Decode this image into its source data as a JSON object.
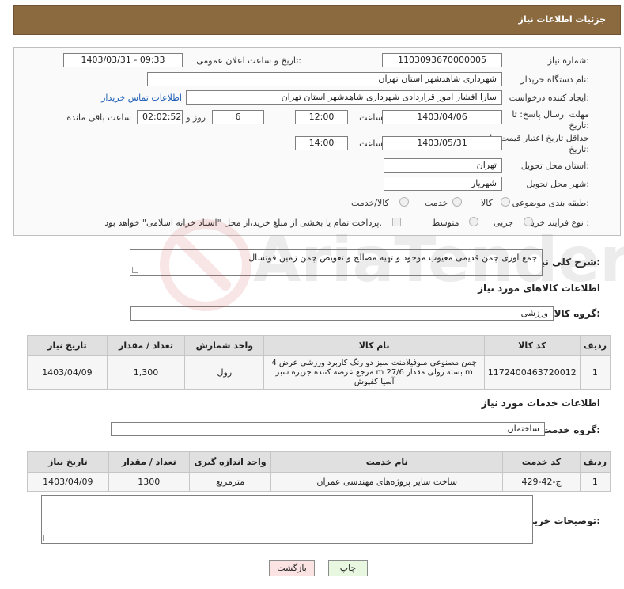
{
  "header": {
    "title": "جزئیات اطلاعات نیاز"
  },
  "info": {
    "need_number": {
      "label": "شماره نیاز:",
      "value": "1103093670000005"
    },
    "announce_datetime": {
      "label": "تاریخ و ساعت اعلان عمومی:",
      "value": "1403/03/31 - 09:33"
    },
    "buyer_org": {
      "label": "نام دستگاه خریدار:",
      "value": "شهرداری شاهدشهر استان تهران"
    },
    "requester": {
      "label": "ایجاد کننده درخواست:",
      "value": "سارا افشار امور قراردادی شهرداری شاهدشهر استان تهران",
      "contact_link": "اطلاعات تماس خریدار"
    },
    "reply_deadline": {
      "label": "مهلت ارسال پاسخ: تا تاریخ:",
      "date": "1403/04/06",
      "time_label": "ساعت",
      "time": "12:00",
      "days": "6",
      "days_label": "روز و",
      "remaining": "02:02:52",
      "remaining_label": "ساعت باقی مانده"
    },
    "price_validity": {
      "label": "حداقل تاریخ اعتبار قیمت: تا تاریخ:",
      "date": "1403/05/31",
      "time_label": "ساعت",
      "time": "14:00"
    },
    "delivery_province": {
      "label": "استان محل تحویل:",
      "value": "تهران"
    },
    "delivery_city": {
      "label": "شهر محل تحویل:",
      "value": "شهریار"
    },
    "category": {
      "label": "طبقه بندی موضوعی:",
      "options": [
        "کالا",
        "خدمت",
        "کالا/خدمت"
      ]
    },
    "process": {
      "label": "نوع فرآیند خرید :",
      "options": [
        "جزیی",
        "متوسط"
      ],
      "payment_note": "پرداخت تمام یا بخشی از مبلغ خرید،از محل \"اسناد خزانه اسلامی\" خواهد بود."
    }
  },
  "description": {
    "label": "شرح کلی نیاز:",
    "value": "جمع آوری چمن قدیمی معیوب موجود و تهیه مصالح و تعویض چمن زمین فوتسال"
  },
  "goods": {
    "section_title": "اطلاعات کالاهای مورد نیاز",
    "group_label": "گروه کالا:",
    "group_value": "ورزشی",
    "headers": [
      "ردیف",
      "کد کالا",
      "نام کالا",
      "واحد شمارش",
      "تعداد / مقدار",
      "تاریخ نیاز"
    ],
    "rows": [
      {
        "row": "1",
        "code": "1172400463720012",
        "name": "چمن مصنوعی منوفیلامنت سبز دو رنگ کاربرد ورزشی عرض 4 m بسته رولی مقدار 27/6 m مرجع عرضه کننده جزیره سبز آسیا کفپوش",
        "unit": "رول",
        "qty": "1,300",
        "date": "1403/04/09"
      }
    ]
  },
  "services": {
    "section_title": "اطلاعات خدمات مورد نیاز",
    "group_label": "گروه خدمت:",
    "group_value": "ساختمان",
    "headers": [
      "ردیف",
      "کد خدمت",
      "نام خدمت",
      "واحد اندازه گیری",
      "تعداد / مقدار",
      "تاریخ نیاز"
    ],
    "rows": [
      {
        "row": "1",
        "code": "ج-42-429",
        "name": "ساخت سایر پروژه‌های مهندسی عمران",
        "unit": "مترمربع",
        "qty": "1300",
        "date": "1403/04/09"
      }
    ]
  },
  "buyer_notes": {
    "label": "توضیحات خریدار:",
    "value": ""
  },
  "buttons": {
    "print": "چاپ",
    "back": "بازگشت"
  },
  "watermark": {
    "text": "AriaTender.net"
  },
  "colors": {
    "header_bg": "#8b6a40",
    "link": "#1f5fb4",
    "print_btn": "#e8f8e0",
    "back_btn": "#fbe3e3"
  }
}
